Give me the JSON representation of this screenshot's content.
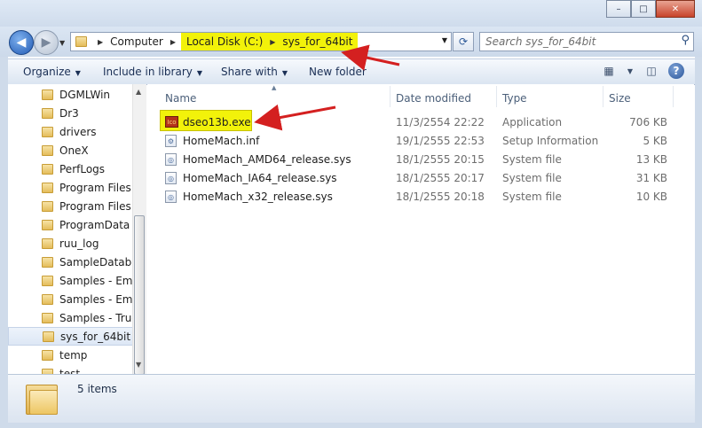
{
  "window": {
    "caption_buttons": [
      "minimize-icon",
      "maximize-icon",
      "close-icon"
    ],
    "caption_glyphs": [
      "–",
      "□",
      "✕"
    ]
  },
  "address": {
    "crumbs": [
      "Computer",
      "Local Disk (C:)",
      "sys_for_64bit"
    ],
    "highlighted_crumbs": [
      "Local Disk (C:)",
      "sys_for_64bit"
    ],
    "search_placeholder": "Search sys_for_64bit"
  },
  "toolbar": {
    "organize": "Organize",
    "include": "Include in library",
    "share": "Share with",
    "new_folder": "New folder"
  },
  "nav": {
    "items": [
      "DGMLWin",
      "Dr3",
      "drivers",
      "OneX",
      "PerfLogs",
      "Program Files",
      "Program Files (",
      "ProgramData",
      "ruu_log",
      "SampleDatabas",
      "Samples - Emb",
      "Samples - Emb",
      "Samples - True",
      "sys_for_64bit",
      "temp",
      "test"
    ],
    "selected": "sys_for_64bit"
  },
  "columns": {
    "name": "Name",
    "date": "Date modified",
    "type": "Type",
    "size": "Size"
  },
  "files": [
    {
      "name": "dseo13b.exe",
      "date": "11/3/2554 22:22",
      "type": "Application",
      "size": "706 KB",
      "icon": "exe-icon",
      "highlighted": true
    },
    {
      "name": "HomeMach.inf",
      "date": "19/1/2555 22:53",
      "type": "Setup Information",
      "size": "5 KB",
      "icon": "inf-file-icon",
      "highlighted": false
    },
    {
      "name": "HomeMach_AMD64_release.sys",
      "date": "18/1/2555 20:15",
      "type": "System file",
      "size": "13 KB",
      "icon": "sys-file-icon",
      "highlighted": false
    },
    {
      "name": "HomeMach_IA64_release.sys",
      "date": "18/1/2555 20:17",
      "type": "System file",
      "size": "31 KB",
      "icon": "sys-file-icon",
      "highlighted": false
    },
    {
      "name": "HomeMach_x32_release.sys",
      "date": "18/1/2555 20:18",
      "type": "System file",
      "size": "10 KB",
      "icon": "sys-file-icon",
      "highlighted": false
    }
  ],
  "status": {
    "count": "5 items"
  },
  "colors": {
    "highlight": "#f2f20a",
    "arrow": "#d42020",
    "toolbar_text": "#1a2f55"
  }
}
